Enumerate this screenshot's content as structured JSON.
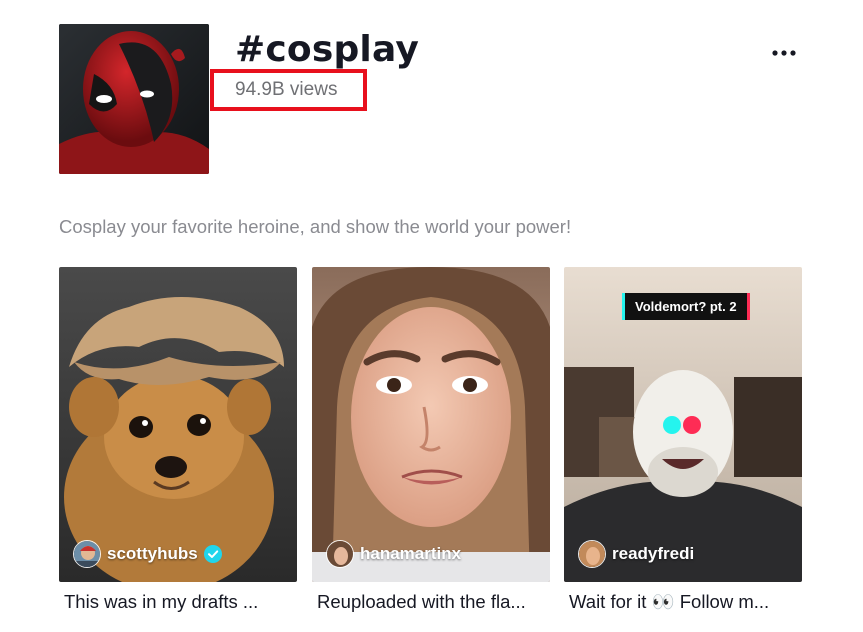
{
  "header": {
    "title": "#cosplay",
    "views": "94.9B views",
    "avatar_icon": "deadpool-avatar"
  },
  "description": "Cosplay your favorite heroine, and show the world your power!",
  "videos": [
    {
      "username": "scottyhubs",
      "verified": true,
      "caption": "This was in my drafts ..."
    },
    {
      "username": "hanamartinx",
      "verified": false,
      "caption": "Reuploaded with the fla..."
    },
    {
      "username": "readyfredi",
      "verified": false,
      "caption": "Wait for it 👀 Follow m...",
      "sticker": "Voldemort? pt. 2"
    }
  ],
  "colors": {
    "highlight": "#e8101d",
    "accent_cyan": "#25f4ee",
    "accent_red": "#fe2c55",
    "verified": "#20d5ec"
  }
}
